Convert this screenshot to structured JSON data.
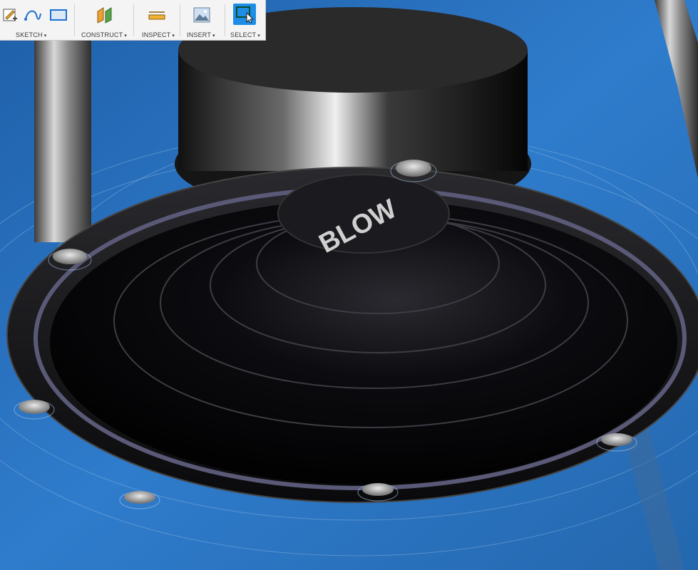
{
  "toolbar": {
    "groups": [
      {
        "label": "SKETCH",
        "tools": [
          "create-sketch-icon",
          "spline-icon",
          "rectangle-icon"
        ]
      },
      {
        "label": "CONSTRUCT",
        "tools": [
          "offset-plane-icon"
        ]
      },
      {
        "label": "INSPECT",
        "tools": [
          "measure-icon"
        ]
      },
      {
        "label": "INSERT",
        "tools": [
          "insert-image-icon"
        ]
      },
      {
        "label": "SELECT",
        "tools": [
          "window-select-icon"
        ]
      }
    ],
    "caret": "▾"
  },
  "model": {
    "engraved_text": "BLOW"
  },
  "colors": {
    "background": "#2a6fb8",
    "active_tool": "#1d8de6",
    "body_dark": "#0b0b10"
  }
}
